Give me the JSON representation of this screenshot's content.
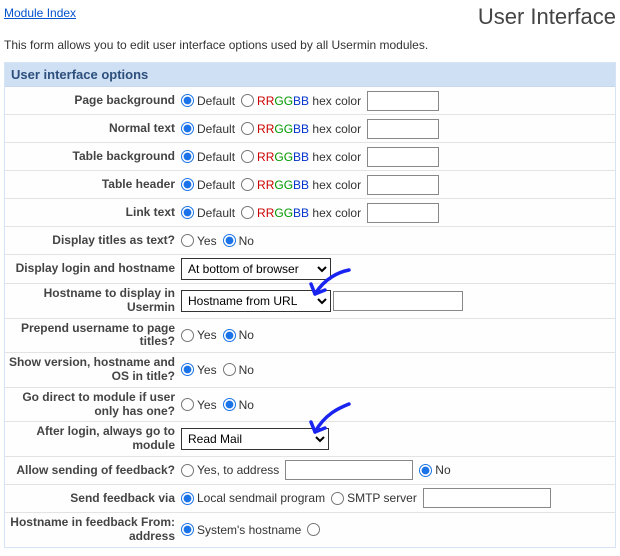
{
  "header": {
    "module_index": "Module Index",
    "title": "User Interface"
  },
  "intro": "This form allows you to edit user interface options used by all Usermin modules.",
  "panel_title": "User interface options",
  "rows": {
    "page_background": "Page background",
    "normal_text": "Normal text",
    "table_background": "Table background",
    "table_header": "Table header",
    "link_text": "Link text",
    "titles_as_text": "Display titles as text?",
    "login_hostname": "Display login and hostname",
    "hostname_display": "Hostname to display in Usermin",
    "prepend_username": "Prepend username to page titles?",
    "version_os": "Show version, hostname and OS in title?",
    "go_direct": "Go direct to module if user only has one?",
    "after_login": "After login, always go to module",
    "allow_feedback": "Allow sending of feedback?",
    "send_feedback_via": "Send feedback via",
    "hostname_feedback": "Hostname in feedback From: address"
  },
  "common": {
    "default": "Default",
    "hex_rr": "RR",
    "hex_gg": "GG",
    "hex_bb": "BB",
    "hex_suffix": " hex color",
    "yes": "Yes",
    "no": "No"
  },
  "options": {
    "login_hostname_select": "At bottom of browser",
    "hostname_display_select": "Hostname from URL",
    "after_login_select": "Read Mail"
  },
  "feedback": {
    "yes_to_address": "Yes, to address ",
    "local_sendmail": "Local sendmail program",
    "smtp_server": "SMTP server",
    "system_hostname": "System's hostname"
  }
}
